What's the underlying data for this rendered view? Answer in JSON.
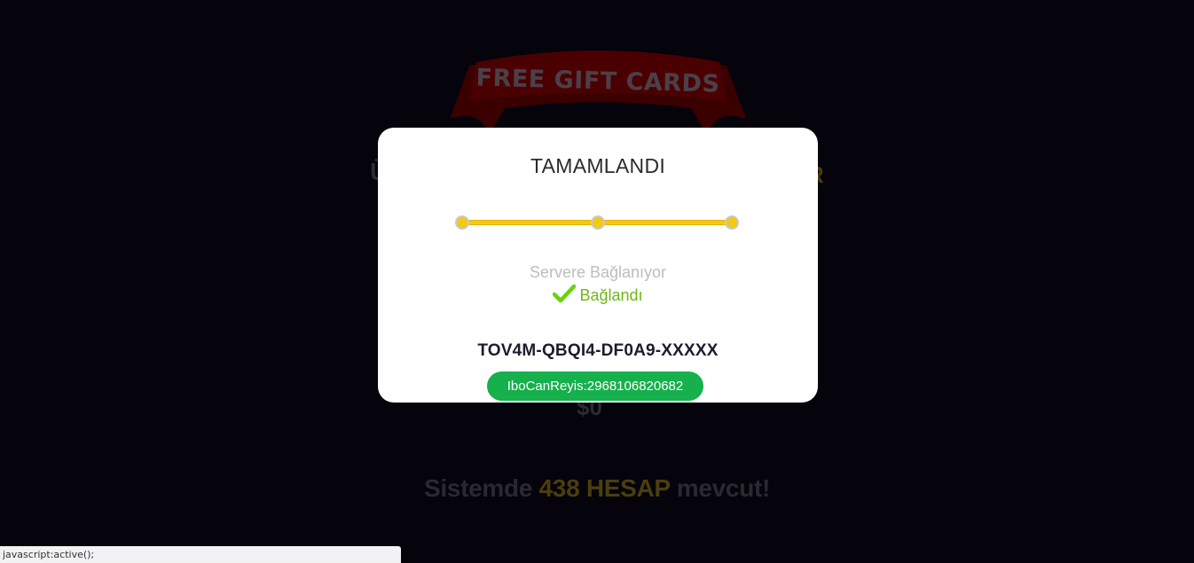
{
  "background": {
    "banner_text": "FREE GIFT CARDS",
    "partial_left": "Ü",
    "partial_right": "R",
    "price": "$0",
    "stock": {
      "prefix": "Sistemde",
      "highlight": "438 HESAP",
      "suffix": "mevcut!"
    }
  },
  "modal": {
    "title": "TAMAMLANDI",
    "progress_steps_completed": 3,
    "progress_steps_total": 3,
    "status_connecting": "Servere Bağlanıyor",
    "status_connected": "Bağlandı",
    "status_icon": "check-icon",
    "code": "TOV4M-QBQI4-DF0A9-XXXXX",
    "pill_label": "IboCanReyis:2968106820682"
  },
  "statusbar": {
    "text": "javascript:active();"
  },
  "colors": {
    "overlay": "#05030b",
    "progress": "#f5c814",
    "success": "#6cb816",
    "pill": "#16b04c"
  }
}
